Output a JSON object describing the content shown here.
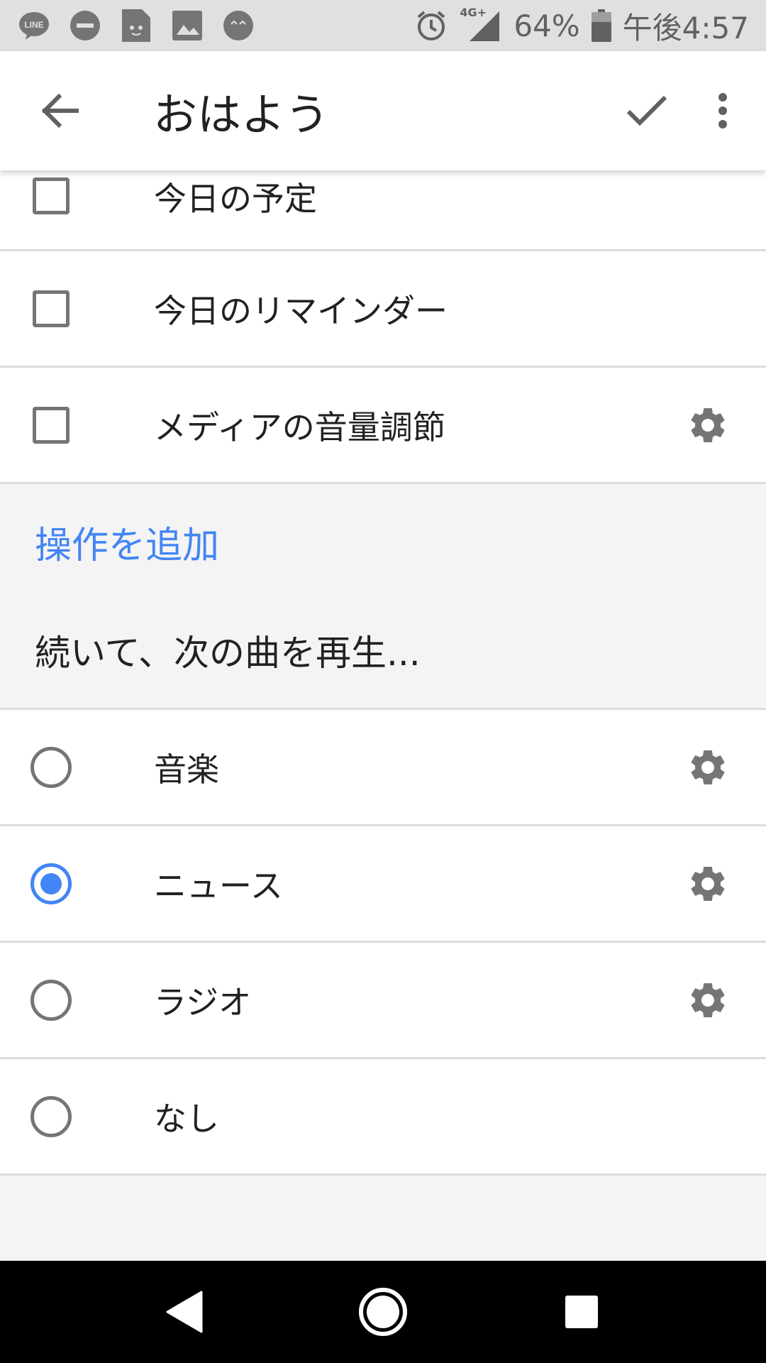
{
  "status_bar": {
    "battery": "64%",
    "time": "午後4:57",
    "network": "4G+",
    "left_icons": [
      "line-icon",
      "do-not-disturb-icon",
      "file-icon",
      "image-icon",
      "face-icon"
    ],
    "right_icons": [
      "alarm-icon",
      "signal-icon",
      "battery-icon"
    ]
  },
  "app_bar": {
    "title": "おはよう",
    "icons": [
      "back-arrow-icon",
      "check-icon",
      "more-vert-icon"
    ]
  },
  "checkbox_items": [
    {
      "label": "今日の予定",
      "checked": false,
      "has_settings": false
    },
    {
      "label": "今日のリマインダー",
      "checked": false,
      "has_settings": false
    },
    {
      "label": "メディアの音量調節",
      "checked": false,
      "has_settings": true
    }
  ],
  "section": {
    "add_action": "操作を追加",
    "subtitle": "続いて、次の曲を再生..."
  },
  "radio_items": [
    {
      "label": "音楽",
      "selected": false,
      "has_settings": true
    },
    {
      "label": "ニュース",
      "selected": true,
      "has_settings": true
    },
    {
      "label": "ラジオ",
      "selected": false,
      "has_settings": true
    },
    {
      "label": "なし",
      "selected": false,
      "has_settings": false
    }
  ],
  "colors": {
    "accent": "#4285f4",
    "icon_gray": "#757575",
    "divider": "#dcdcdc",
    "background": "#f4f4f4"
  }
}
